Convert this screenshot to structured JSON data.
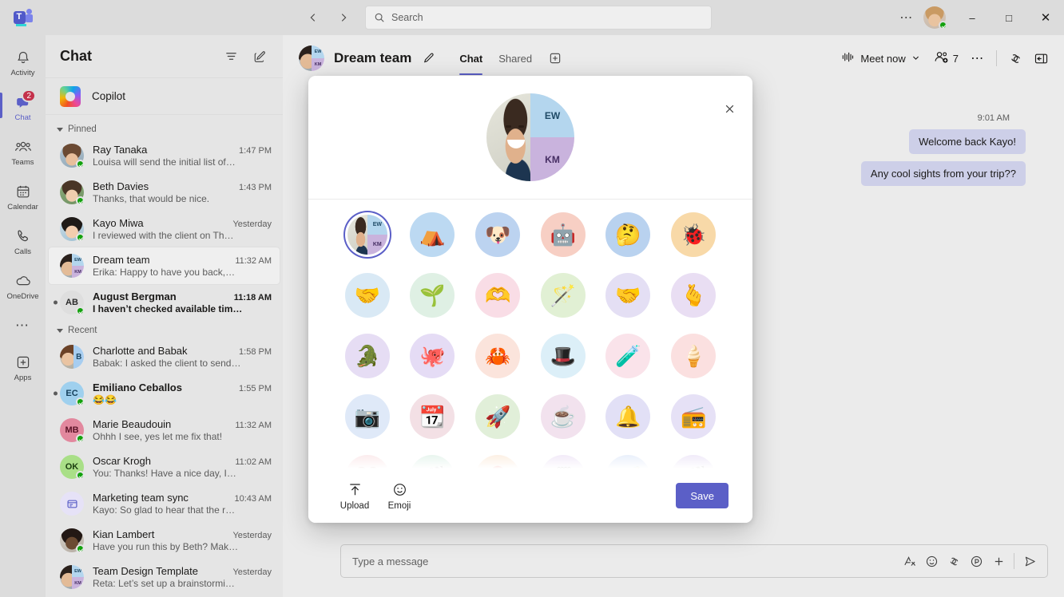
{
  "titlebar": {
    "logo_icon": "teams-logo",
    "back_icon": "chevron-left-icon",
    "forward_icon": "chevron-right-icon",
    "search_placeholder": "Search",
    "search_icon": "search-icon",
    "more_icon": "ellipsis-icon",
    "avatar_name": "user-avatar",
    "minimize_label": "–",
    "maximize_label": "□",
    "close_label": "✕"
  },
  "rail": {
    "items": [
      {
        "label": "Activity",
        "icon": "bell-icon",
        "badge": null,
        "active": false
      },
      {
        "label": "Chat",
        "icon": "chat-icon",
        "badge": "2",
        "active": true
      },
      {
        "label": "Teams",
        "icon": "people-icon",
        "badge": null,
        "active": false
      },
      {
        "label": "Calendar",
        "icon": "calendar-icon",
        "badge": null,
        "active": false
      },
      {
        "label": "Calls",
        "icon": "phone-icon",
        "badge": null,
        "active": false
      },
      {
        "label": "OneDrive",
        "icon": "cloud-icon",
        "badge": null,
        "active": false
      }
    ],
    "more_icon": "ellipsis-icon",
    "apps_label": "Apps",
    "apps_icon": "plus-square-icon"
  },
  "chatlist": {
    "title": "Chat",
    "filter_icon": "filter-icon",
    "compose_icon": "compose-icon",
    "copilot_label": "Copilot",
    "sections": [
      {
        "label": "Pinned",
        "items": [
          {
            "name": "Ray Tanaka",
            "preview": "Louisa will send the initial list of…",
            "time": "1:47 PM",
            "avatar": "photo",
            "initials": "",
            "unread": false,
            "selected": false,
            "presence": true
          },
          {
            "name": "Beth Davies",
            "preview": "Thanks, that would be nice.",
            "time": "1:43 PM",
            "avatar": "photo2",
            "initials": "",
            "unread": false,
            "selected": false,
            "presence": true
          },
          {
            "name": "Kayo Miwa",
            "preview": "I reviewed with the client on Th…",
            "time": "Yesterday",
            "avatar": "photo3",
            "initials": "",
            "unread": false,
            "selected": false,
            "presence": true
          },
          {
            "name": "Dream team",
            "preview": "Erika: Happy to have you back,…",
            "time": "11:32 AM",
            "avatar": "group",
            "initials": "",
            "unread": false,
            "selected": true,
            "presence": false
          },
          {
            "name": "August Bergman",
            "preview": "I haven’t checked available tim…",
            "time": "11:18 AM",
            "avatar": "initials",
            "initials": "AB",
            "unread": true,
            "selected": false,
            "presence": true
          }
        ]
      },
      {
        "label": "Recent",
        "items": [
          {
            "name": "Charlotte and Babak",
            "preview": "Babak: I asked the client to send…",
            "time": "1:58 PM",
            "avatar": "photo-initial",
            "initials": "B",
            "unread": false,
            "selected": false,
            "presence": false
          },
          {
            "name": "Emiliano Ceballos",
            "preview": "😂😂",
            "time": "1:55 PM",
            "avatar": "initials",
            "initials": "EC",
            "unread": true,
            "selected": false,
            "presence": true
          },
          {
            "name": "Marie Beaudouin",
            "preview": "Ohhh I see, yes let me fix that!",
            "time": "11:32 AM",
            "avatar": "initials",
            "initials": "MB",
            "unread": false,
            "selected": false,
            "presence": true
          },
          {
            "name": "Oscar Krogh",
            "preview": "You: Thanks! Have a nice day, I…",
            "time": "11:02 AM",
            "avatar": "initials",
            "initials": "OK",
            "unread": false,
            "selected": false,
            "presence": true
          },
          {
            "name": "Marketing team sync",
            "preview": "Kayo: So glad to hear that the r…",
            "time": "10:43 AM",
            "avatar": "doc",
            "initials": "",
            "unread": false,
            "selected": false,
            "presence": false
          },
          {
            "name": "Kian Lambert",
            "preview": "Have you run this by Beth? Mak…",
            "time": "Yesterday",
            "avatar": "photo4",
            "initials": "",
            "unread": false,
            "selected": false,
            "presence": true
          },
          {
            "name": "Team Design Template",
            "preview": "Reta: Let’s set up a brainstormi…",
            "time": "Yesterday",
            "avatar": "group",
            "initials": "",
            "unread": false,
            "selected": false,
            "presence": false
          }
        ]
      }
    ]
  },
  "chat_header": {
    "title": "Dream team",
    "edit_icon": "pencil-icon",
    "tabs": [
      {
        "label": "Chat",
        "active": true
      },
      {
        "label": "Shared",
        "active": false
      }
    ],
    "add_tab_icon": "plus-square-icon",
    "meet_now_label": "Meet now",
    "meet_now_icon": "audio-wave-icon",
    "meet_now_chevron": "chevron-down-icon",
    "people_count": "7",
    "people_icon": "people-add-icon",
    "more_icon": "ellipsis-icon",
    "copilot_icon": "copilot-icon",
    "panel_icon": "open-panel-icon"
  },
  "messages": {
    "timestamp": "9:01 AM",
    "bubbles": [
      {
        "text": "Welcome back Kayo!"
      },
      {
        "text": "Any cool sights from your trip??"
      }
    ]
  },
  "composer": {
    "placeholder": "Type a message",
    "buttons": [
      {
        "icon": "format-icon",
        "name": "format-button"
      },
      {
        "icon": "emoji-icon",
        "name": "emoji-button"
      },
      {
        "icon": "copilot-icon",
        "name": "copilot-button"
      },
      {
        "icon": "loop-icon",
        "name": "loop-button"
      },
      {
        "icon": "plus-icon",
        "name": "more-options-button"
      }
    ],
    "send_icon": "send-icon"
  },
  "modal": {
    "close_icon": "close-icon",
    "hero": {
      "initials_top": "EW",
      "initials_bottom": "KM"
    },
    "avatars": [
      {
        "type": "group",
        "top": "EW",
        "bottom": "KM",
        "selected": true,
        "bg": "#ffffff",
        "name": "current-group-avatar"
      },
      {
        "type": "emoji",
        "glyph": "⛺",
        "selected": false,
        "bg": "#bcd9f2",
        "name": "camping-avatar"
      },
      {
        "type": "emoji",
        "glyph": "🐶",
        "selected": false,
        "bg": "#bcd3f0",
        "name": "dog-avatar"
      },
      {
        "type": "emoji",
        "glyph": "🤖",
        "selected": false,
        "bg": "#f7cfc4",
        "name": "robot-avatar"
      },
      {
        "type": "emoji",
        "glyph": "🤔",
        "selected": false,
        "bg": "#b9d2ef",
        "name": "thinking-face-avatar"
      },
      {
        "type": "emoji",
        "glyph": "🐞",
        "selected": false,
        "bg": "#f8d9a8",
        "name": "bug-avatar"
      },
      {
        "type": "emoji",
        "glyph": "🤝",
        "selected": false,
        "bg": "#d9e9f5",
        "name": "handshake-avatar"
      },
      {
        "type": "emoji",
        "glyph": "🌱",
        "selected": false,
        "bg": "#dff0e4",
        "name": "seedling-hand-avatar"
      },
      {
        "type": "emoji",
        "glyph": "🫶",
        "selected": false,
        "bg": "#f9dde6",
        "name": "holding-heart-avatar"
      },
      {
        "type": "emoji",
        "glyph": "🪄",
        "selected": false,
        "bg": "#e1f0d4",
        "name": "magic-wand-avatar"
      },
      {
        "type": "emoji",
        "glyph": "🤝",
        "selected": false,
        "bg": "#e4dff4",
        "name": "shake-hands-avatar"
      },
      {
        "type": "emoji",
        "glyph": "🫰",
        "selected": false,
        "bg": "#e9def3",
        "name": "heart-hands-avatar"
      },
      {
        "type": "emoji",
        "glyph": "🐊",
        "selected": false,
        "bg": "#e6ddf4",
        "name": "crocodile-avatar"
      },
      {
        "type": "emoji",
        "glyph": "🐙",
        "selected": false,
        "bg": "#e5dcf5",
        "name": "octopus-avatar"
      },
      {
        "type": "emoji",
        "glyph": "🦀",
        "selected": false,
        "bg": "#fbe4dc",
        "name": "crab-avatar"
      },
      {
        "type": "emoji",
        "glyph": "🎩",
        "selected": false,
        "bg": "#dceff8",
        "name": "magic-hat-rabbit-avatar"
      },
      {
        "type": "emoji",
        "glyph": "🧪",
        "selected": false,
        "bg": "#fae3ea",
        "name": "potion-avatar"
      },
      {
        "type": "emoji",
        "glyph": "🍦",
        "selected": false,
        "bg": "#fbe0e0",
        "name": "ice-cream-avatar"
      },
      {
        "type": "emoji",
        "glyph": "📷",
        "selected": false,
        "bg": "#dfe9f8",
        "name": "camera-avatar"
      },
      {
        "type": "emoji",
        "glyph": "📆",
        "selected": false,
        "bg": "#f3e0e5",
        "name": "calendar-avatar"
      },
      {
        "type": "emoji",
        "glyph": "🚀",
        "selected": false,
        "bg": "#e1efd9",
        "name": "rocket-avatar"
      },
      {
        "type": "emoji",
        "glyph": "☕",
        "selected": false,
        "bg": "#f2e2ee",
        "name": "teacup-avatar"
      },
      {
        "type": "emoji",
        "glyph": "🔔",
        "selected": false,
        "bg": "#e2e0f6",
        "name": "bell-avatar"
      },
      {
        "type": "emoji",
        "glyph": "📻",
        "selected": false,
        "bg": "#e6e1f6",
        "name": "radio-avatar"
      },
      {
        "type": "emoji",
        "glyph": "🤎",
        "selected": false,
        "bg": "#fae2e4",
        "name": "brown-heart-avatar"
      },
      {
        "type": "emoji",
        "glyph": "🎬",
        "selected": false,
        "bg": "#ddf0e6",
        "name": "film-reel-avatar"
      },
      {
        "type": "emoji",
        "glyph": "🎈",
        "selected": false,
        "bg": "#fbe8d5",
        "name": "hot-air-balloon-avatar"
      },
      {
        "type": "emoji",
        "glyph": "🗒",
        "selected": false,
        "bg": "#ece0f5",
        "name": "whiteboard-avatar"
      },
      {
        "type": "emoji",
        "glyph": "🎸",
        "selected": false,
        "bg": "#dee8f9",
        "name": "guitar-avatar"
      },
      {
        "type": "emoji",
        "glyph": "🎬",
        "selected": false,
        "bg": "#e9e0f6",
        "name": "video-folder-avatar"
      }
    ],
    "footer": {
      "upload_label": "Upload",
      "upload_icon": "upload-icon",
      "emoji_label": "Emoji",
      "emoji_icon": "emoji-icon",
      "save_label": "Save"
    }
  },
  "colors": {
    "accent": "#5b5fc7",
    "badge": "#c4314b",
    "presence": "#13a10e",
    "bubble": "#cdcfe8"
  }
}
